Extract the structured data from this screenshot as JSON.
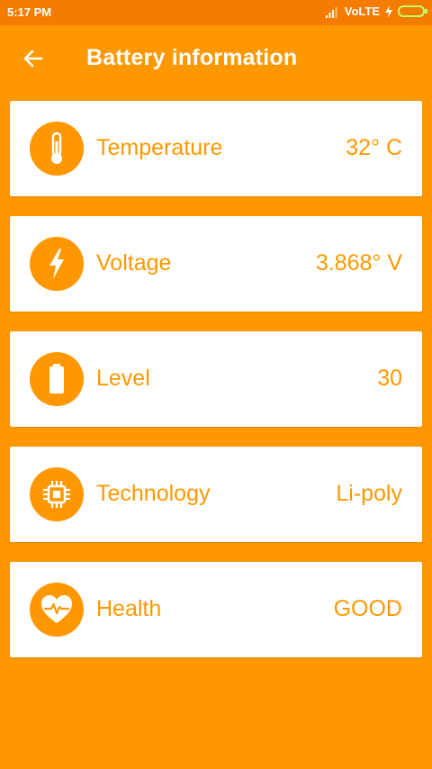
{
  "status_bar": {
    "time": "5:17 PM",
    "network": "VoLTE",
    "icons": [
      "signal-icon",
      "charging-bolt-icon",
      "battery-icon"
    ]
  },
  "toolbar": {
    "title": "Battery information",
    "back_icon": "back-arrow-icon"
  },
  "cards": [
    {
      "icon": "thermometer-icon",
      "label": "Temperature",
      "value": "32° C"
    },
    {
      "icon": "lightning-icon",
      "label": "Voltage",
      "value": "3.868° V"
    },
    {
      "icon": "battery-icon",
      "label": "Level",
      "value": "30"
    },
    {
      "icon": "chip-icon",
      "label": "Technology",
      "value": "Li-poly"
    },
    {
      "icon": "heart-pulse-icon",
      "label": "Health",
      "value": "GOOD"
    }
  ],
  "colors": {
    "background": "#FF9800",
    "status_bar": "#F47C00",
    "card": "#FFFFFF",
    "accent": "#FF9800",
    "battery_indicator": "#B9FF6E"
  }
}
